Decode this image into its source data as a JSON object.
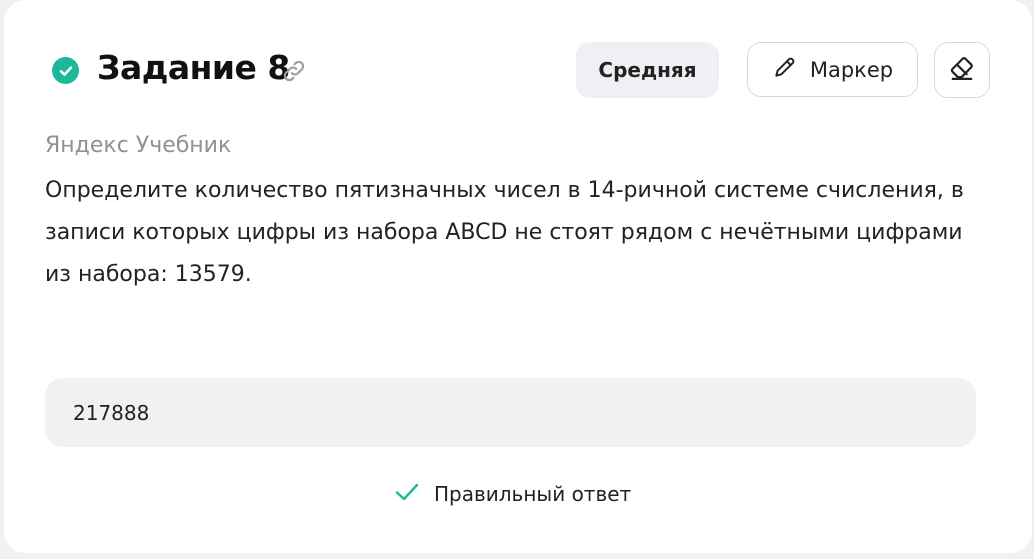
{
  "task": {
    "title": "Задание 8",
    "difficulty": "Средняя",
    "source": "Яндекс Учебник",
    "question": "Определите количество пятизначных чисел в 14-ричной системе счисления, в записи которых цифры из набора ABCD не стоят рядом с нечётными цифрами из набора: 13579.",
    "status_icon": "check-circle-icon",
    "link_icon": "link-icon"
  },
  "toolbar": {
    "marker_label": "Маркер",
    "marker_icon": "pencil-icon",
    "eraser_icon": "eraser-icon"
  },
  "answer": {
    "value": "217888"
  },
  "result": {
    "label": "Правильный ответ",
    "icon": "checkmark-icon"
  },
  "colors": {
    "accent": "#1db89a",
    "background": "#f0f1f3",
    "text": "#222222",
    "muted": "#8e9297"
  }
}
